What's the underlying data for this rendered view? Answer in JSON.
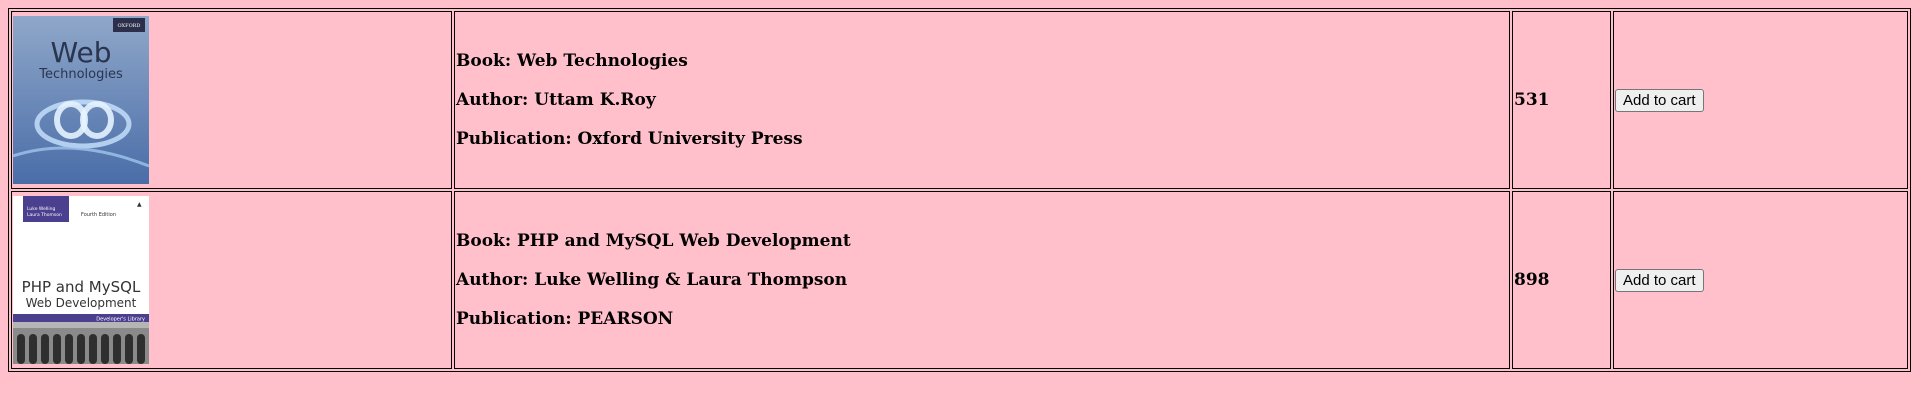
{
  "books": [
    {
      "book_label": "Book: Web Technologies",
      "author_label": "Author: Uttam K.Roy",
      "publication_label": "Publication: Oxford University Press",
      "price": "531",
      "cart_button": "Add to cart",
      "cover": {
        "publisher_badge": "OXFORD",
        "title_line1": "Web",
        "title_line2": "Technologies",
        "bg_top": "#8fa7c9",
        "bg_bottom": "#4a6da8"
      }
    },
    {
      "book_label": "Book: PHP and MySQL Web Development",
      "author_label": "Author: Luke Welling & Laura Thompson",
      "publication_label": "Publication: PEARSON",
      "price": "898",
      "cart_button": "Add to cart",
      "cover": {
        "authors": "Luke Welling\nLaura Thomson",
        "edition": "Fourth Edition",
        "title_line1": "PHP and MySQL",
        "title_line2": "Web Development",
        "series": "Developer's Library",
        "band_color": "#4b3f8f"
      }
    }
  ]
}
